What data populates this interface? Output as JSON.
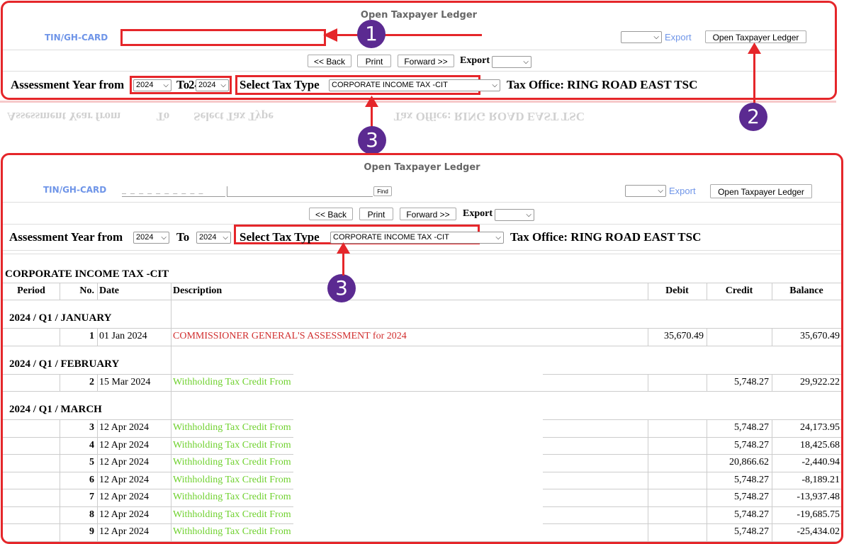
{
  "title": "Open Taxpayer Ledger",
  "tin_label": "TIN/GH-CARD",
  "tin_mask": "_ _ _ _ _ _ _ _ _ _",
  "find_label": "Find",
  "export_link": "Export",
  "open_ledger_button": "Open Taxpayer Ledger",
  "nav": {
    "back": "<< Back",
    "print": "Print",
    "forward": "Forward >>",
    "export_label": "Export"
  },
  "filters": {
    "assessment_year_from": "Assessment Year from",
    "from_value": "2024",
    "to_label": "To",
    "to_value": "2024",
    "select_tax_type": "Select Tax Type",
    "tax_type_value": "CORPORATE INCOME TAX -CIT",
    "tax_office": "Tax Office: RING ROAD EAST TSC"
  },
  "annotations": {
    "one": "1",
    "two": "2",
    "three": "3"
  },
  "ledger": {
    "heading": "CORPORATE INCOME TAX -CIT",
    "columns": [
      "Period",
      "No.",
      "Date",
      "Description",
      "Debit",
      "Credit",
      "Balance"
    ],
    "groups": [
      {
        "period": "2024 / Q1 / JANUARY",
        "rows": [
          {
            "no": "1",
            "date": "01 Jan 2024",
            "desc": "COMMISSIONER GENERAL'S ASSESSMENT for 2024",
            "kind": "red",
            "debit": "35,670.49",
            "credit": "",
            "balance": "35,670.49"
          }
        ]
      },
      {
        "period": "2024 / Q1 / FEBRUARY",
        "rows": [
          {
            "no": "2",
            "date": "15 Mar 2024",
            "desc": "Withholding Tax Credit From",
            "kind": "green",
            "debit": "",
            "credit": "5,748.27",
            "balance": "29,922.22"
          }
        ]
      },
      {
        "period": "2024 / Q1 / MARCH",
        "rows": [
          {
            "no": "3",
            "date": "12 Apr 2024",
            "desc": "Withholding Tax Credit From",
            "kind": "green",
            "debit": "",
            "credit": "5,748.27",
            "balance": "24,173.95"
          },
          {
            "no": "4",
            "date": "12 Apr 2024",
            "desc": "Withholding Tax Credit From",
            "kind": "green",
            "debit": "",
            "credit": "5,748.27",
            "balance": "18,425.68"
          },
          {
            "no": "5",
            "date": "12 Apr 2024",
            "desc": "Withholding Tax Credit From",
            "kind": "green",
            "debit": "",
            "credit": "20,866.62",
            "balance": "-2,440.94"
          },
          {
            "no": "6",
            "date": "12 Apr 2024",
            "desc": "Withholding Tax Credit From",
            "kind": "green",
            "debit": "",
            "credit": "5,748.27",
            "balance": "-8,189.21"
          },
          {
            "no": "7",
            "date": "12 Apr 2024",
            "desc": "Withholding Tax Credit From",
            "kind": "green",
            "debit": "",
            "credit": "5,748.27",
            "balance": "-13,937.48"
          },
          {
            "no": "8",
            "date": "12 Apr 2024",
            "desc": "Withholding Tax Credit From",
            "kind": "green",
            "debit": "",
            "credit": "5,748.27",
            "balance": "-19,685.75"
          },
          {
            "no": "9",
            "date": "12 Apr 2024",
            "desc": "Withholding Tax Credit From",
            "kind": "green",
            "debit": "",
            "credit": "5,748.27",
            "balance": "-25,434.02"
          }
        ]
      }
    ]
  },
  "colors": {
    "highlight": "#e5262a",
    "badge": "#5b2a91",
    "link": "#6f95e8",
    "debit_desc": "#d12e2e",
    "credit_desc": "#6fd12e"
  }
}
